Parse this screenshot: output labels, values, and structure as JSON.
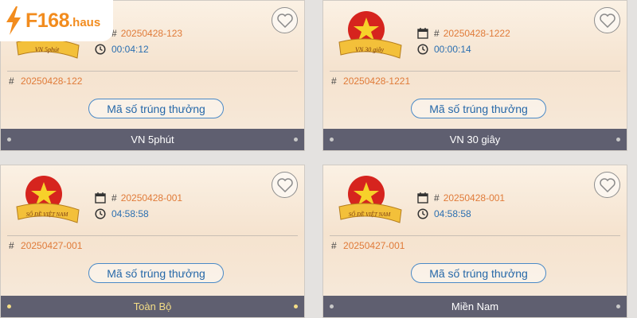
{
  "logo": {
    "brand": "F168",
    "tld": ".haus"
  },
  "colors": {
    "accent_orange": "#e07b39",
    "time_blue": "#2b6fb0",
    "footer_bg": "#5f5f70",
    "active_footer_text": "#f4dd86"
  },
  "cards": [
    {
      "badge_text": "VN 5phút",
      "current_draw": "20250428-123",
      "countdown": "00:04:12",
      "previous_draw": "20250428-122",
      "button_label": "Mã số trúng thưởng",
      "footer_label": "VN 5phút",
      "active": false
    },
    {
      "badge_text": "VN 30 giây",
      "current_draw": "20250428-1222",
      "countdown": "00:00:14",
      "previous_draw": "20250428-1221",
      "button_label": "Mã số trúng thưởng",
      "footer_label": "VN 30 giây",
      "active": false
    },
    {
      "badge_text": "SỐ ĐỀ VIỆT NAM",
      "current_draw": "20250428-001",
      "countdown": "04:58:58",
      "previous_draw": "20250427-001",
      "button_label": "Mã số trúng thưởng",
      "footer_label": "Toàn Bộ",
      "active": true
    },
    {
      "badge_text": "SỐ ĐỀ VIỆT NAM",
      "current_draw": "20250428-001",
      "countdown": "04:58:58",
      "previous_draw": "20250427-001",
      "button_label": "Mã số trúng thưởng",
      "footer_label": "Miền Nam",
      "active": false
    }
  ],
  "hash_symbol": "#"
}
